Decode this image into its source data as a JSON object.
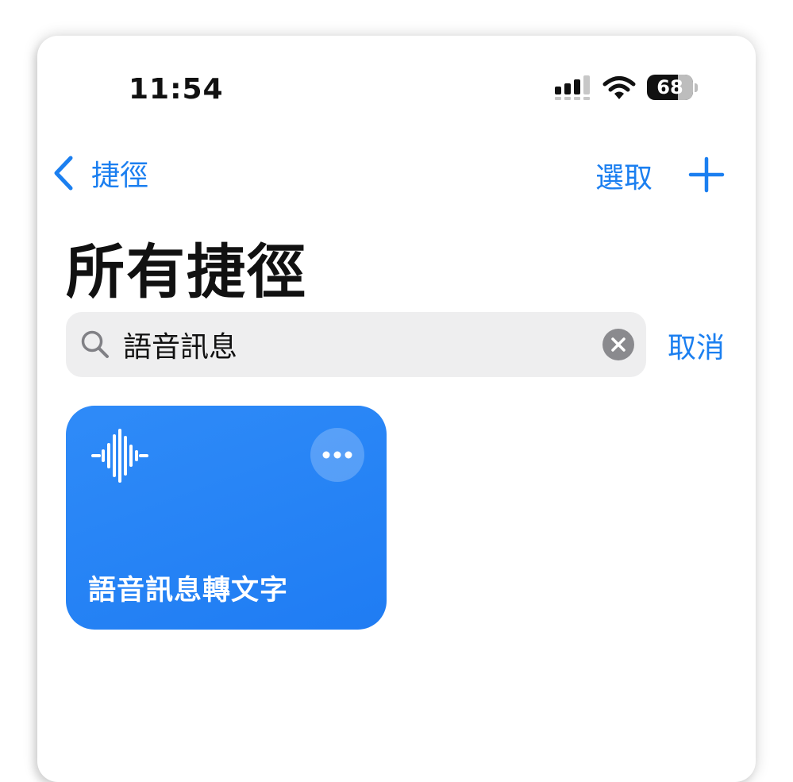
{
  "status_bar": {
    "time": "11:54",
    "battery": {
      "level_percent": 68,
      "label": "68"
    },
    "icons": [
      "cellular-signal-icon",
      "wifi-icon",
      "battery-icon"
    ]
  },
  "nav": {
    "back_label": "捷徑",
    "select_label": "選取",
    "add_icon": "plus-icon"
  },
  "page_title": "所有捷徑",
  "search": {
    "value": "語音訊息",
    "icon": "magnifier-icon",
    "clear_icon": "clear-x-icon",
    "cancel_label": "取消"
  },
  "shortcuts": [
    {
      "title": "語音訊息轉文字",
      "icon": "waveform-icon",
      "more_icon": "ellipsis-icon",
      "color": "#2683f5"
    }
  ],
  "colors": {
    "accent": "#1b7ff0",
    "card": "#2683f5",
    "search_bg": "#eeeeef"
  }
}
